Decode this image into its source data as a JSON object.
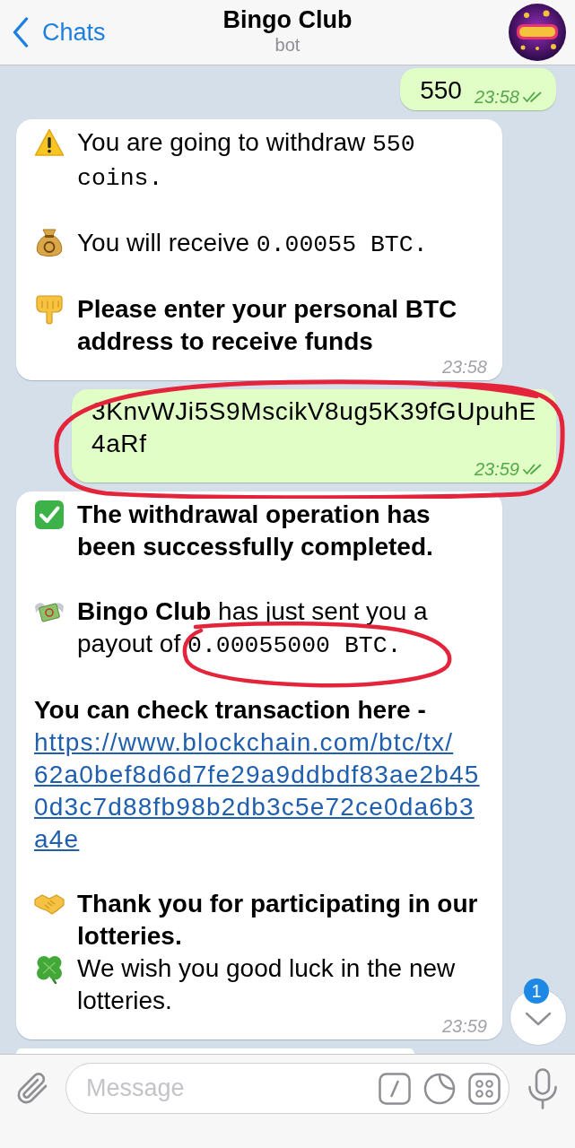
{
  "header": {
    "back_label": "Chats",
    "title": "Bingo Club",
    "subtitle": "bot"
  },
  "messages": [
    {
      "kind": "outgoing",
      "paragraphs": [
        {
          "sentences": [
            {
              "kind": "text",
              "text": "550"
            }
          ]
        }
      ],
      "time": "23:58",
      "read": true
    },
    {
      "kind": "incoming",
      "paragraphs": [
        {
          "sentences": [
            {
              "kind": "warning",
              "text": "You are going to withdraw",
              "amount": "550 coins."
            }
          ]
        },
        {
          "sentences": [
            {
              "kind": "receive",
              "text": "You will receive",
              "amount": "0.00055 BTC."
            }
          ]
        },
        {
          "sentences": [
            {
              "kind": "prompt",
              "text": "Please enter your personal BTC address to receive funds"
            }
          ]
        }
      ],
      "time": "23:58"
    },
    {
      "kind": "outgoing",
      "highlighted": true,
      "paragraphs": [
        {
          "sentences": [
            {
              "kind": "address",
              "text": "3KnvWJi5S9MscikV8ug5K39fGUpuhE4aRf"
            }
          ]
        }
      ],
      "time": "23:59",
      "read": true
    },
    {
      "kind": "incoming",
      "paragraphs": [
        {
          "sentences": [
            {
              "kind": "success",
              "text": "The withdrawal operation has been successfully completed."
            }
          ]
        },
        {
          "sentences": [
            {
              "kind": "payout",
              "highlighted": true,
              "text": "**Bingo Club** has just sent you a payout of",
              "amount": "0.00055000 BTC."
            }
          ]
        },
        {
          "sentences": [
            {
              "kind": "note",
              "text": "You can check transaction here -"
            },
            {
              "kind": "link",
              "text": "https://www.blockchain.com/btc/tx/62a0bef8d6d7fe29a9ddbdf83ae2b450d3c7d88fb98b2db3c5e72ce0da6b3a4e"
            }
          ]
        },
        {
          "sentences": [
            {
              "kind": "thanks",
              "text": "Thank you for participating in our lotteries."
            },
            {
              "kind": "wish",
              "text": "We wish you good luck in the new lotteries."
            }
          ]
        }
      ],
      "time": "23:59"
    },
    {
      "kind": "incoming"
    }
  ],
  "scroll_button": {
    "badge": "1"
  },
  "composer": {
    "placeholder": "Message"
  }
}
